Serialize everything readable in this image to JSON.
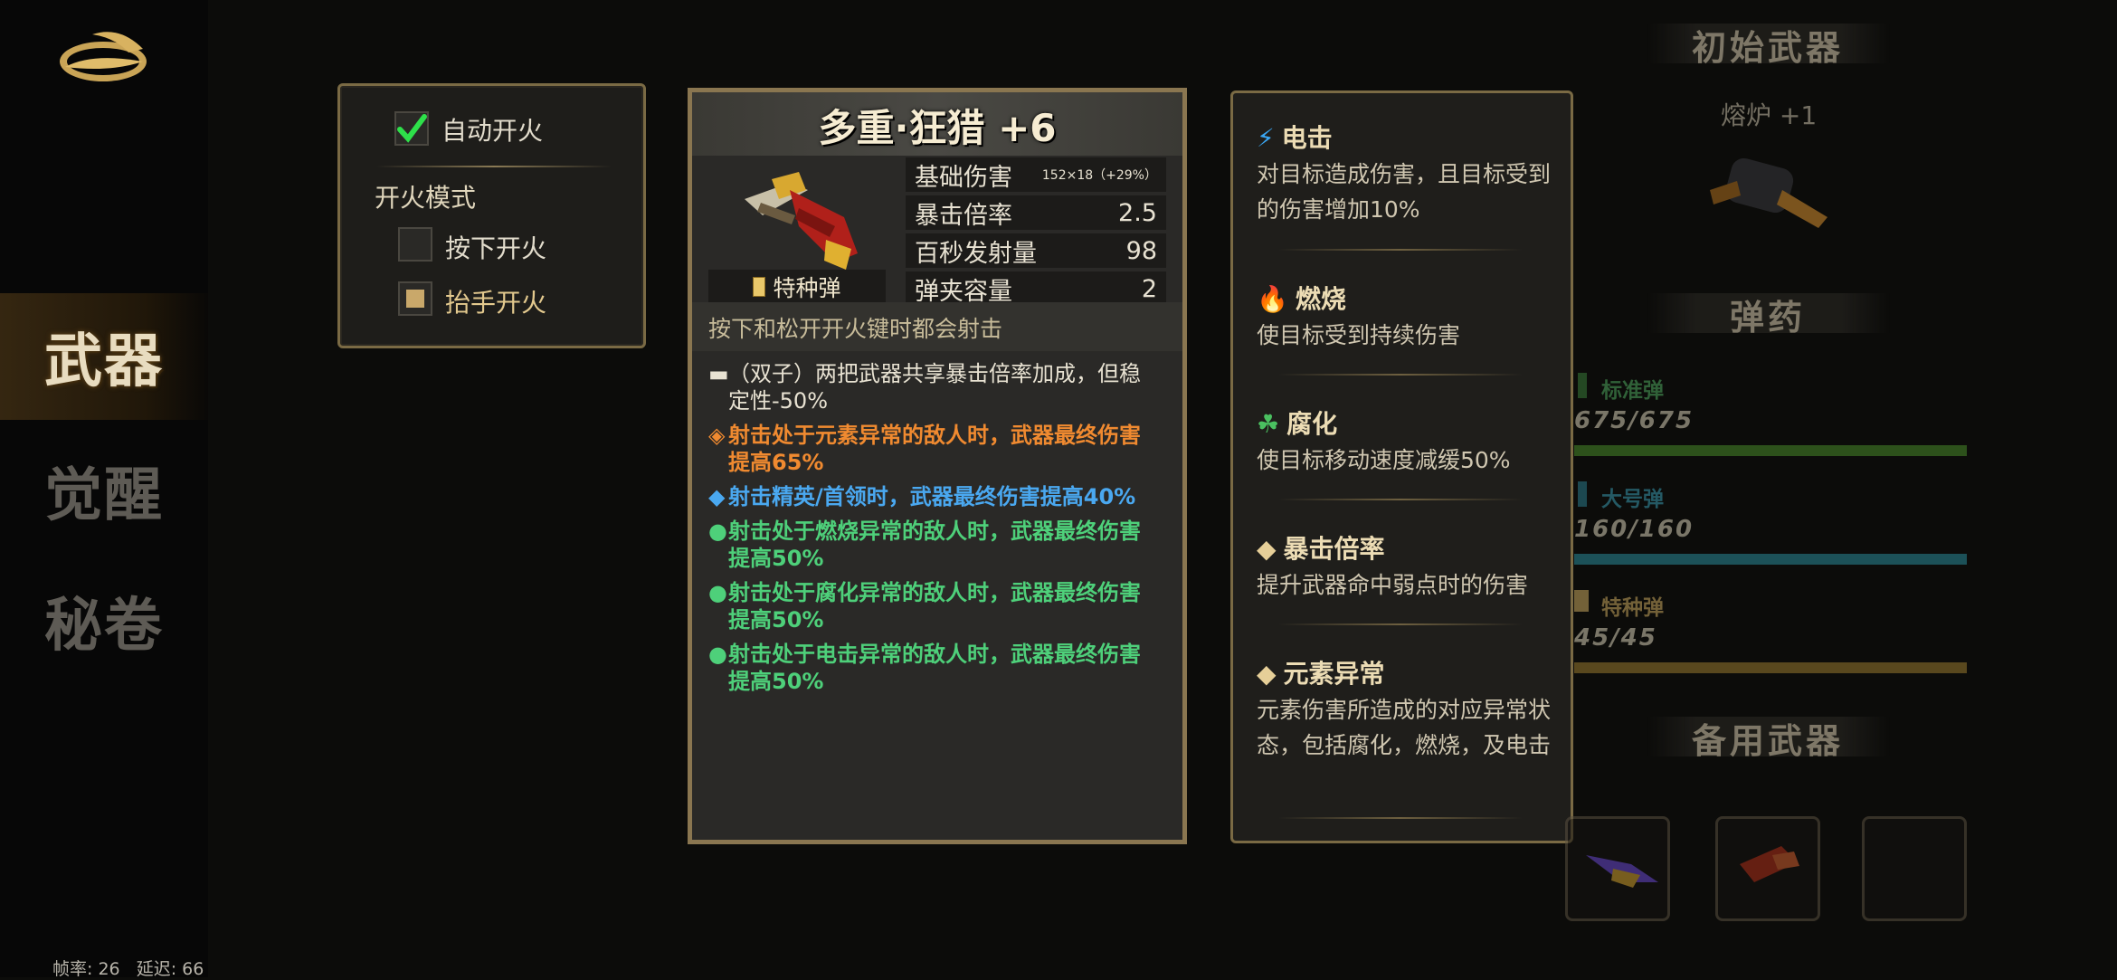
{
  "sidebar": {
    "items": [
      {
        "label": "武器",
        "active": true
      },
      {
        "label": "觉醒",
        "active": false
      },
      {
        "label": "秘卷",
        "active": false
      }
    ],
    "stats": "帧率: 26   延迟: 66"
  },
  "fire_options": {
    "auto_fire": {
      "label": "自动开火",
      "checked": true
    },
    "mode_title": "开火模式",
    "press_fire": {
      "label": "按下开火",
      "checked": false
    },
    "release_fire": {
      "label": "抬手开火",
      "checked": true
    }
  },
  "weapon": {
    "name": "多重·狂猎 +6",
    "ammo_type": "特种弹",
    "stats": [
      {
        "label": "基础伤害",
        "value": "152×18（+29%）"
      },
      {
        "label": "暴击倍率",
        "value": "2.5"
      },
      {
        "label": "百秒发射量",
        "value": "98"
      },
      {
        "label": "弹夹容量",
        "value": "2"
      }
    ],
    "description": "按下和松开开火键时都会射击",
    "lines": [
      {
        "bullet": "▬",
        "color": "white",
        "text": "（双子）两把武器共享暴击倍率加成，但稳定性-50%"
      },
      {
        "bullet": "◈",
        "color": "orange",
        "text": "射击处于元素异常的敌人时，武器最终伤害提高65%"
      },
      {
        "bullet": "◆",
        "color": "blue",
        "text": "射击精英/首领时，武器最终伤害提高40%"
      },
      {
        "bullet": "●",
        "color": "green",
        "text": "射击处于燃烧异常的敌人时，武器最终伤害提高50%"
      },
      {
        "bullet": "●",
        "color": "green",
        "text": "射击处于腐化异常的敌人时，武器最终伤害提高50%"
      },
      {
        "bullet": "●",
        "color": "green",
        "text": "射击处于电击异常的敌人时，武器最终伤害提高50%"
      }
    ]
  },
  "effects": [
    {
      "icon": "lightning-icon",
      "glyph": "⚡",
      "glyph_color": "#3aa6f2",
      "title": "电击",
      "text": "对目标造成伤害，且目标受到的伤害增加10%"
    },
    {
      "icon": "fire-icon",
      "glyph": "🔥",
      "glyph_color": "#ee6a2a",
      "title": "燃烧",
      "text": "使目标受到持续伤害"
    },
    {
      "icon": "corrosion-icon",
      "glyph": "☘",
      "glyph_color": "#4ac060",
      "title": "腐化",
      "text": "使目标移动速度减缓50%"
    },
    {
      "icon": "diamond-icon",
      "glyph": "◆",
      "glyph_color": "#e6cf98",
      "title": "暴击倍率",
      "text": "提升武器命中弱点时的伤害"
    },
    {
      "icon": "diamond-icon",
      "glyph": "◆",
      "glyph_color": "#e6cf98",
      "title": "元素异常",
      "text": "元素伤害所造成的对应异常状态，包括腐化，燃烧，及电击"
    }
  ],
  "right_panel": {
    "initial_weapon_title": "初始武器",
    "initial_weapon_name": "熔炉 +1",
    "ammo_title": "弹药",
    "ammo": [
      {
        "name": "标准弹",
        "count": "675/675",
        "fill": 1.0,
        "color": "#4a8a2a"
      },
      {
        "name": "大号弹",
        "count": "160/160",
        "fill": 1.0,
        "color": "#2a8a9a"
      },
      {
        "name": "特种弹",
        "count": "45/45",
        "fill": 1.0,
        "color": "#9a7a30"
      }
    ],
    "backup_title": "备用武器"
  }
}
